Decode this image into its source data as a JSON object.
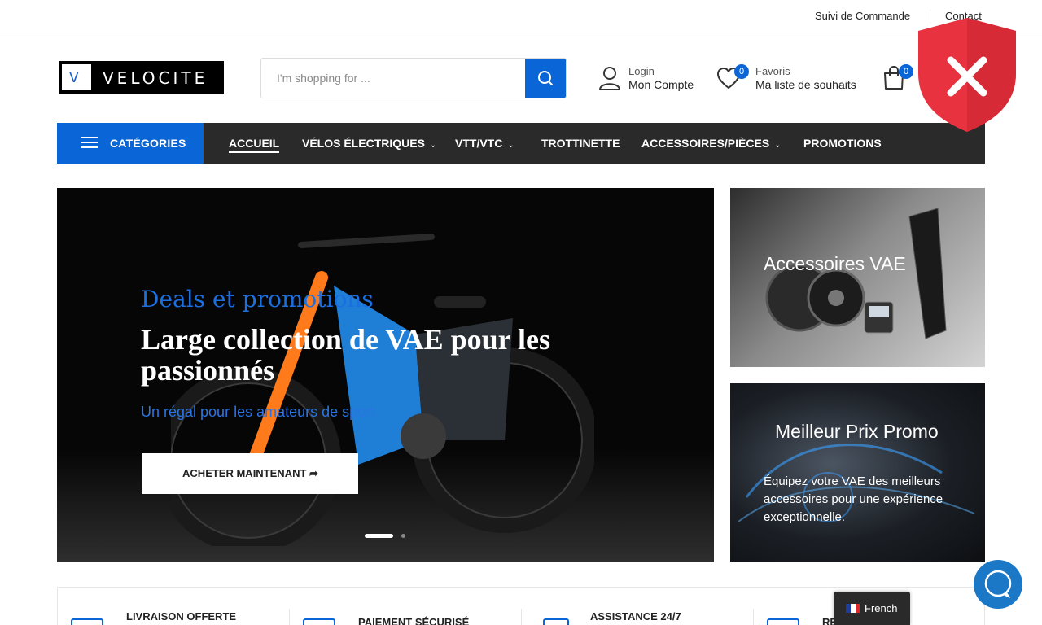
{
  "topbar": {
    "order_tracking": "Suivi de Commande",
    "contact": "Contact"
  },
  "header": {
    "logo_text": "VELOCITE",
    "logo_mark": "V",
    "search": {
      "placeholder": "I'm shopping for ..."
    },
    "account": {
      "small": "Login",
      "big": "Mon Compte"
    },
    "wishlist": {
      "small": "Favoris",
      "big": "Ma liste de souhaits",
      "count": "0"
    },
    "cart": {
      "count": "0"
    }
  },
  "nav": {
    "categories_label": "CATÉGORIES",
    "items": [
      {
        "label": "ACCUEIL",
        "active": true
      },
      {
        "label": "VÉLOS ÉLECTRIQUES",
        "dropdown": true
      },
      {
        "label": "VTT/VTC",
        "dropdown": true
      },
      {
        "label": "TROTTINETTE"
      },
      {
        "label": "ACCESSOIRES/PIÈCES",
        "dropdown": true
      },
      {
        "label": "PROMOTIONS"
      }
    ]
  },
  "hero": {
    "eyebrow": "Deals et promotions",
    "headline": "Large collection de VAE pour les passionnés",
    "subtitle": "Un régal pour les amateurs de sport",
    "cta": "ACHETER MAINTENANT",
    "slides_total": 2,
    "active_slide": 1
  },
  "promo_cards": [
    {
      "title": "Accessoires VAE"
    },
    {
      "title": "Meilleur Prix Promo",
      "description": "Équipez votre VAE des meilleurs accessoires pour une expérience exceptionnelle."
    }
  ],
  "features": [
    {
      "label": "LIVRAISON OFFERTE"
    },
    {
      "label": "PAIEMENT SÉCURISÉ"
    },
    {
      "label": "ASSISTANCE 24/7"
    },
    {
      "label": "RE"
    }
  ],
  "language_switcher": {
    "label": "French"
  },
  "colors": {
    "accent": "#0a66d6",
    "nav_bg": "#2a2a2a",
    "shield": "#e8323f",
    "chat": "#1a78c7"
  },
  "icons": {
    "search": "search-icon",
    "account": "user-icon",
    "wishlist": "heart-icon",
    "cart": "shopping-bag-icon",
    "categories": "hamburger-menu-icon",
    "overlay": "shield-x-icon",
    "chat": "chat-bubble-icon"
  }
}
